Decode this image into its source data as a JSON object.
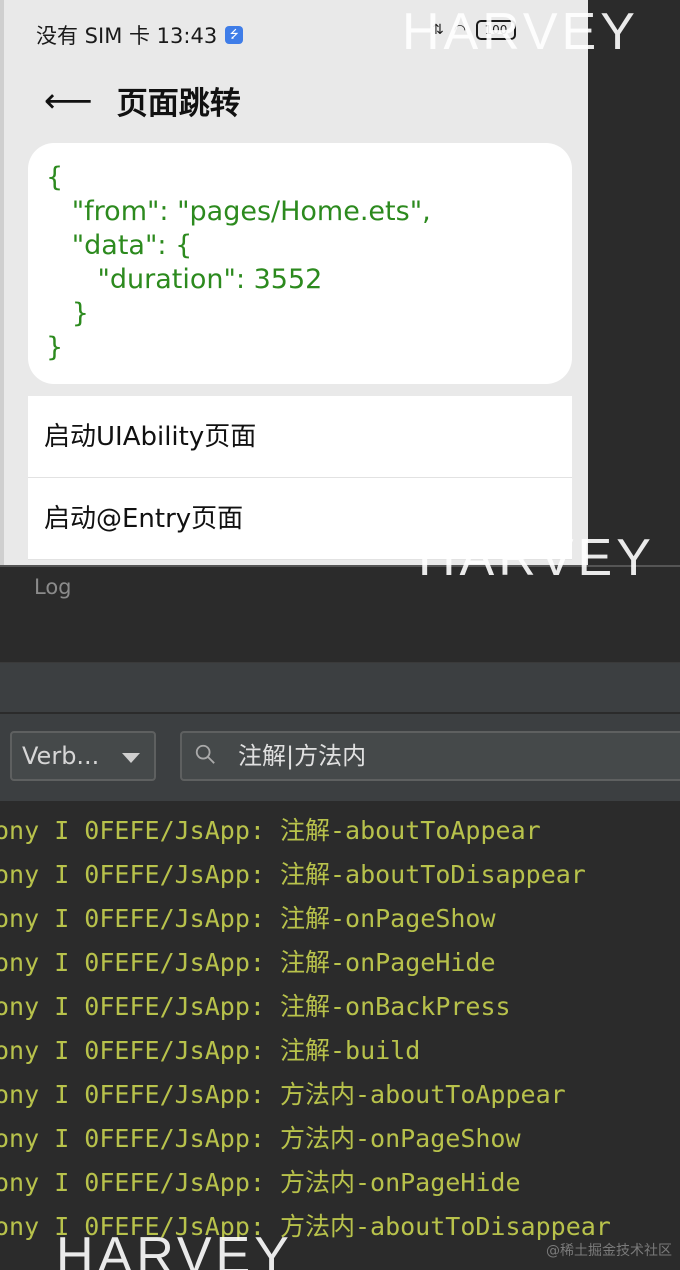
{
  "phone": {
    "status": {
      "carrier_time": "没有 SIM 卡 13:43",
      "battery": "100"
    },
    "header": {
      "title": "页面跳转"
    },
    "json_text": "{\n   \"from\": \"pages/Home.ets\",\n   \"data\": {\n      \"duration\": 3552\n   }\n}",
    "list_items": [
      "启动UIAbility页面",
      "启动@Entry页面"
    ]
  },
  "ide": {
    "tab": "Log",
    "level_select": "Verb...",
    "search_value": "注解|方法内",
    "log_lines": [
      "ony I 0FEFE/JsApp: 注解-aboutToAppear",
      "ony I 0FEFE/JsApp: 注解-aboutToDisappear",
      "ony I 0FEFE/JsApp: 注解-onPageShow",
      "ony I 0FEFE/JsApp: 注解-onPageHide",
      "ony I 0FEFE/JsApp: 注解-onBackPress",
      "ony I 0FEFE/JsApp: 注解-build",
      "ony I 0FEFE/JsApp: 方法内-aboutToAppear",
      "ony I 0FEFE/JsApp: 方法内-onPageShow",
      "ony I 0FEFE/JsApp: 方法内-onPageHide",
      "ony I 0FEFE/JsApp: 方法内-aboutToDisappear"
    ]
  },
  "watermarks": [
    "HARVEY",
    "HARVEY",
    "HARVEY"
  ],
  "credit": "@稀土掘金技术社区",
  "colors": {
    "json_green": "#2c8a1e",
    "log_yellow": "#b8c24b",
    "ide_bg": "#2b2b2b"
  }
}
